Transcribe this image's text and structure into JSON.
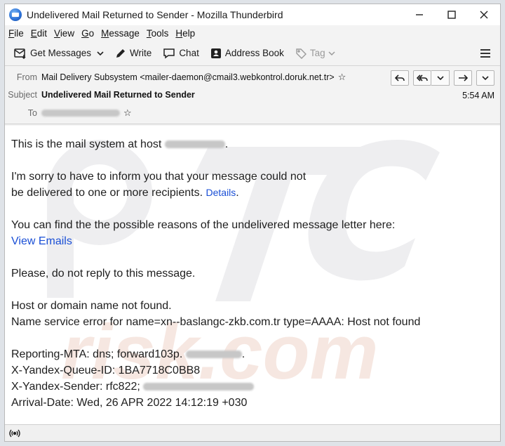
{
  "window": {
    "title": "Undelivered Mail Returned to Sender - Mozilla Thunderbird",
    "minimize_icon": "minimize-icon",
    "maximize_icon": "maximize-icon",
    "close_icon": "close-icon"
  },
  "menubar": {
    "items": [
      {
        "u": "F",
        "rest": "ile"
      },
      {
        "u": "E",
        "rest": "dit"
      },
      {
        "u": "V",
        "rest": "iew"
      },
      {
        "u": "G",
        "rest": "o"
      },
      {
        "u": "M",
        "rest": "essage"
      },
      {
        "u": "T",
        "rest": "ools"
      },
      {
        "u": "H",
        "rest": "elp"
      }
    ]
  },
  "toolbar": {
    "get_messages": "Get Messages",
    "write": "Write",
    "chat": "Chat",
    "address_book": "Address Book",
    "tag": "Tag"
  },
  "headers": {
    "from_label": "From",
    "from_value": "Mail Delivery Subsystem <mailer-daemon@cmail3.webkontrol.doruk.net.tr>",
    "subject_label": "Subject",
    "subject_value": "Undelivered Mail Returned to Sender",
    "to_label": "To",
    "time": "5:54 AM"
  },
  "body": {
    "line1": "This is the mail system at host",
    "line1_end": ".",
    "line2": "I'm sorry to have to inform you that your message could not",
    "line3": "be delivered to one or more recipients.",
    "details_link": "Details",
    "line3_end": ".",
    "line4": "You can find the the possible reasons of the undelivered message letter here:",
    "view_emails_link": "View Emails",
    "line5": "Please, do not reply to this message.",
    "line6": "Host or domain name not found.",
    "line7": "Name service error for name=xn--baslangc-zkb.com.tr type=AAAA: Host not found",
    "line8": "Reporting-MTA: dns; forward103p.",
    "line8_end": ".",
    "line9": "X-Yandex-Queue-ID: 1BA7718C0BB8",
    "line10": "X-Yandex-Sender: rfc822;",
    "line11": "Arrival-Date: Wed, 26 APR 2022 14:12:19 +030"
  },
  "colors": {
    "link": "#1a4fd6",
    "window_bg": "#f3f3f3",
    "body_bg": "#ffffff"
  }
}
